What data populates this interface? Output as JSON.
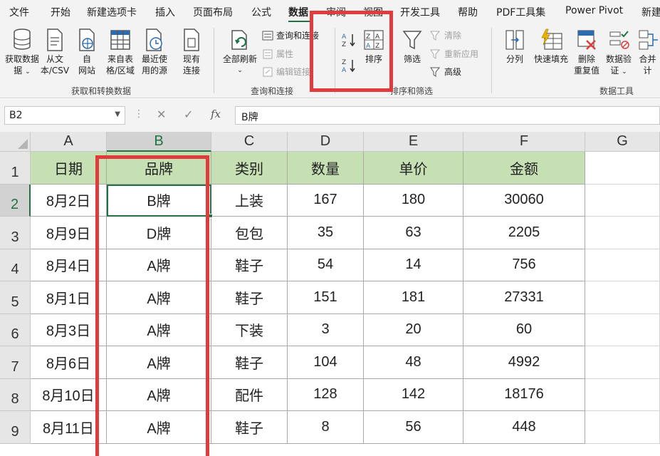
{
  "menu": {
    "items": [
      "文件",
      "开始",
      "新建选项卡",
      "插入",
      "页面布局",
      "公式",
      "数据",
      "审阅",
      "视图",
      "开发工具",
      "帮助",
      "PDF工具集",
      "Power Pivot",
      "新建"
    ],
    "active": "数据"
  },
  "ribbon": {
    "get_data": "获取数据",
    "get_data_line2": "据",
    "from_text_line1": "从文",
    "from_text_line2": "本/CSV",
    "from_web_line1": "自",
    "from_web_line2": "网站",
    "from_table_line1": "来自表",
    "from_table_line2": "格/区域",
    "recent_line1": "最近使",
    "recent_line2": "用的源",
    "existing_line1": "现有",
    "existing_line2": "连接",
    "group_get_transform": "获取和转换数据",
    "refresh_all": "全部刷新",
    "queries_connections": "查询和连接",
    "properties": "属性",
    "edit_links": "编辑链接",
    "group_queries": "查询和连接",
    "sort": "排序",
    "filter": "筛选",
    "clear": "清除",
    "reapply": "重新应用",
    "advanced": "高级",
    "group_sort_filter": "排序和筛选",
    "split": "分列",
    "flash_fill": "快速填充",
    "remove_dup_line1": "删除",
    "remove_dup_line2": "重复值",
    "validation_line1": "数据验",
    "validation_line2": "证",
    "consolidate": "合并计",
    "group_data_tools": "数据工具"
  },
  "formula_bar": {
    "name_box": "B2",
    "fx": "fx",
    "content": "B牌"
  },
  "sheet": {
    "columns": [
      "A",
      "B",
      "C",
      "D",
      "E",
      "F",
      "G"
    ],
    "rows": [
      "1",
      "2",
      "3",
      "4",
      "5",
      "6",
      "7",
      "8",
      "9"
    ],
    "headers": [
      "日期",
      "品牌",
      "类别",
      "数量",
      "单价",
      "金额"
    ],
    "data": [
      [
        "8月2日",
        "B牌",
        "上装",
        "167",
        "180",
        "30060"
      ],
      [
        "8月9日",
        "D牌",
        "包包",
        "35",
        "63",
        "2205"
      ],
      [
        "8月4日",
        "A牌",
        "鞋子",
        "54",
        "14",
        "756"
      ],
      [
        "8月1日",
        "A牌",
        "鞋子",
        "151",
        "181",
        "27331"
      ],
      [
        "8月3日",
        "A牌",
        "下装",
        "3",
        "20",
        "60"
      ],
      [
        "8月6日",
        "A牌",
        "鞋子",
        "104",
        "48",
        "4992"
      ],
      [
        "8月10日",
        "A牌",
        "配件",
        "128",
        "142",
        "18176"
      ],
      [
        "8月11日",
        "A牌",
        "鞋子",
        "8",
        "56",
        "448"
      ]
    ]
  },
  "colors": {
    "accent": "#217346",
    "header_fill": "#c6e0b4",
    "highlight": "#e03c3c"
  }
}
